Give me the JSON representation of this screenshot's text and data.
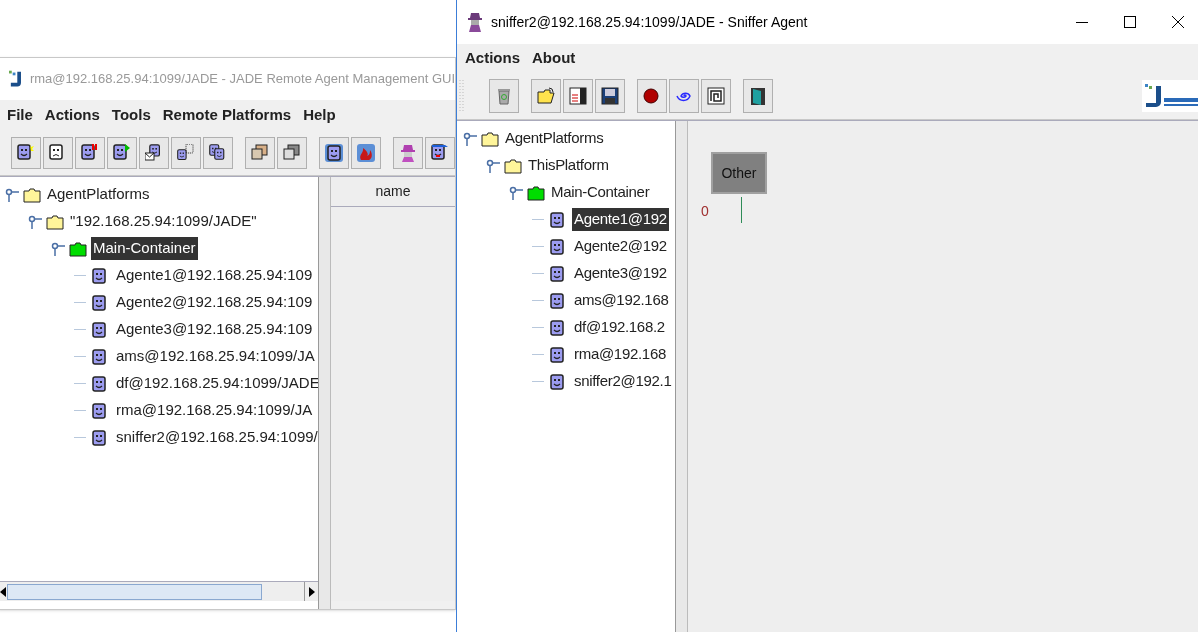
{
  "rma_window": {
    "title": "rma@192.168.25.94:1099/JADE - JADE Remote Agent Management GUI",
    "menu": [
      "File",
      "Actions",
      "Tools",
      "Remote Platforms",
      "Help"
    ],
    "tree": [
      {
        "label": "AgentPlatforms",
        "kind": "folder",
        "selected": false,
        "expanded": true,
        "children": [
          {
            "label": "\"192.168.25.94:1099/JADE\"",
            "kind": "folder",
            "selected": false,
            "expanded": true,
            "children": [
              {
                "label": "Main-Container",
                "kind": "container",
                "selected": true,
                "expanded": true,
                "children": [
                  {
                    "label": "Agente1@192.168.25.94:109",
                    "kind": "agent",
                    "selected": false
                  },
                  {
                    "label": "Agente2@192.168.25.94:109",
                    "kind": "agent",
                    "selected": false
                  },
                  {
                    "label": "Agente3@192.168.25.94:109",
                    "kind": "agent",
                    "selected": false
                  },
                  {
                    "label": "ams@192.168.25.94:1099/JA",
                    "kind": "agent",
                    "selected": false
                  },
                  {
                    "label": "df@192.168.25.94:1099/JADE",
                    "kind": "agent",
                    "selected": false
                  },
                  {
                    "label": "rma@192.168.25.94:1099/JA",
                    "kind": "agent",
                    "selected": false
                  },
                  {
                    "label": "sniffer2@192.168.25.94:1099/",
                    "kind": "agent",
                    "selected": false
                  }
                ]
              }
            ]
          }
        ]
      }
    ],
    "table": {
      "columns": [
        "name"
      ]
    }
  },
  "sniffer_window": {
    "title": "sniffer2@192.168.25.94:1099/JADE - Sniffer Agent",
    "menu": [
      "Actions",
      "About"
    ],
    "tree": [
      {
        "label": "AgentPlatforms",
        "kind": "folder",
        "selected": false,
        "expanded": true,
        "children": [
          {
            "label": "ThisPlatform",
            "kind": "folder",
            "selected": false,
            "expanded": true,
            "children": [
              {
                "label": "Main-Container",
                "kind": "container",
                "selected": false,
                "expanded": true,
                "children": [
                  {
                    "label": "Agente1@192",
                    "kind": "agent",
                    "selected": true
                  },
                  {
                    "label": "Agente2@192",
                    "kind": "agent",
                    "selected": false
                  },
                  {
                    "label": "Agente3@192",
                    "kind": "agent",
                    "selected": false
                  },
                  {
                    "label": "ams@192.168",
                    "kind": "agent",
                    "selected": false
                  },
                  {
                    "label": "df@192.168.2",
                    "kind": "agent",
                    "selected": false
                  },
                  {
                    "label": "rma@192.168",
                    "kind": "agent",
                    "selected": false
                  },
                  {
                    "label": "sniffer2@192.1",
                    "kind": "agent",
                    "selected": false
                  }
                ]
              }
            ]
          }
        ]
      }
    ],
    "canvas": {
      "agents": [
        {
          "label": "Other"
        }
      ],
      "timeline": [
        "0"
      ]
    }
  }
}
